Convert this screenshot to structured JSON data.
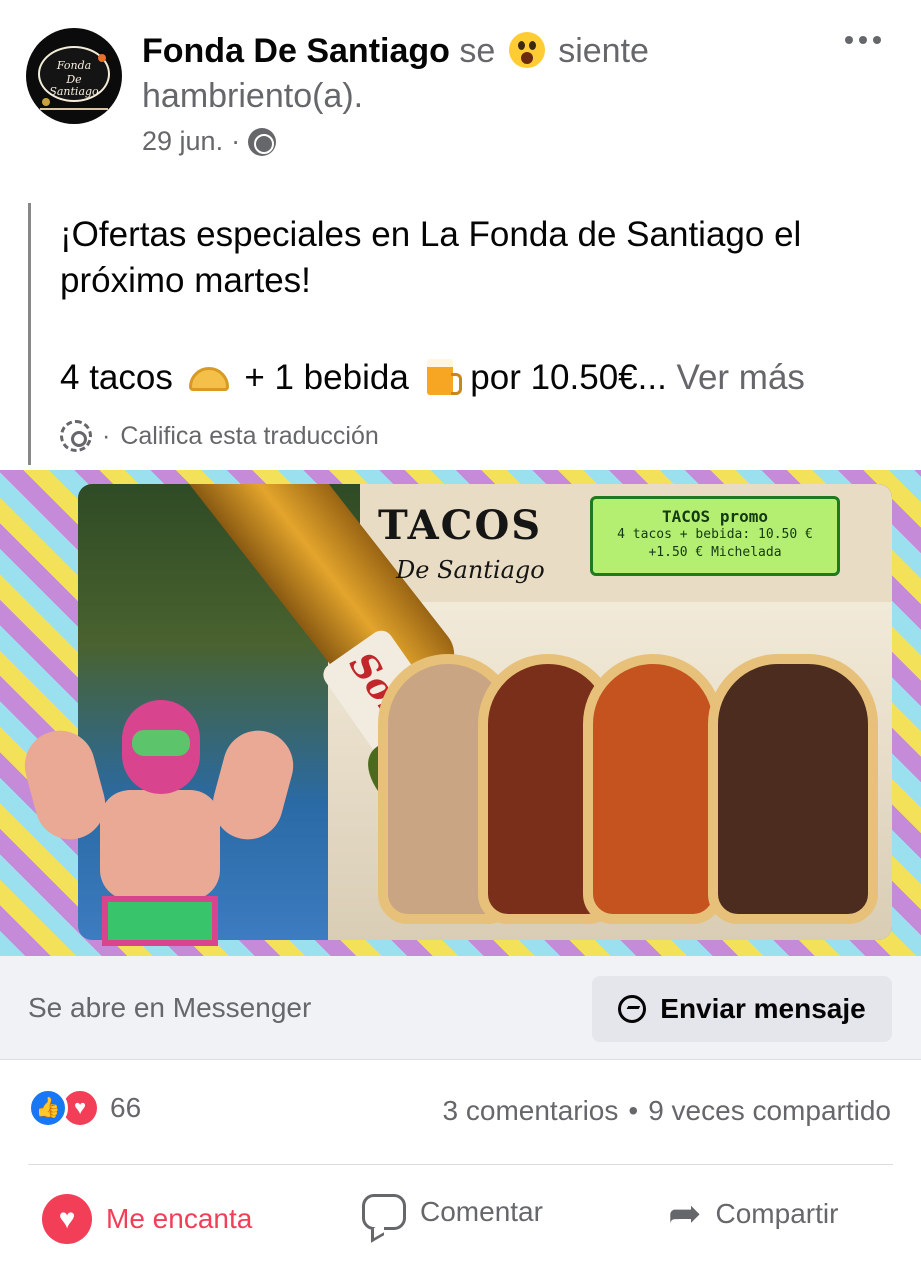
{
  "post": {
    "page_name": "Fonda De Santiago",
    "feeling_prefix": "se",
    "feeling_suffix": "siente",
    "feeling_line2": "hambriento(a).",
    "date": "29 jun.",
    "date_separator": "·",
    "privacy_icon": "globe-icon",
    "more_icon": "more-horizontal-icon",
    "avatar_text": {
      "line1": "Fonda",
      "line2": "De Santiago"
    }
  },
  "body": {
    "paragraph1": "¡Ofertas especiales en La Fonda de Santiago el próximo martes!",
    "line3_part1": "4 tacos",
    "line3_part2": "+ 1 bebida",
    "line3_part3": "por 10.50€...",
    "see_more": "Ver más",
    "translation_separator": "·",
    "translation_label": "Califica esta traducción"
  },
  "image": {
    "title": "TACOS",
    "subtitle": "De Santiago",
    "promo_title": "TACOS promo",
    "promo_line1": "4 tacos + bebida: 10.50 €",
    "promo_line2": "+1.50 € Michelada",
    "bottle_label": "Sol"
  },
  "cta": {
    "caption": "Se abre en Messenger",
    "button_label": "Enviar mensaje"
  },
  "stats": {
    "reaction_count": "66",
    "comments": "3 comentarios",
    "separator": "•",
    "shares": "9 veces compartido"
  },
  "actions": {
    "love": "Me encanta",
    "comment": "Comentar",
    "share": "Compartir"
  },
  "colors": {
    "like_blue": "#1877f2",
    "love_red": "#f33e58",
    "secondary_text": "#65676b",
    "cta_background": "#f0f2f5"
  }
}
